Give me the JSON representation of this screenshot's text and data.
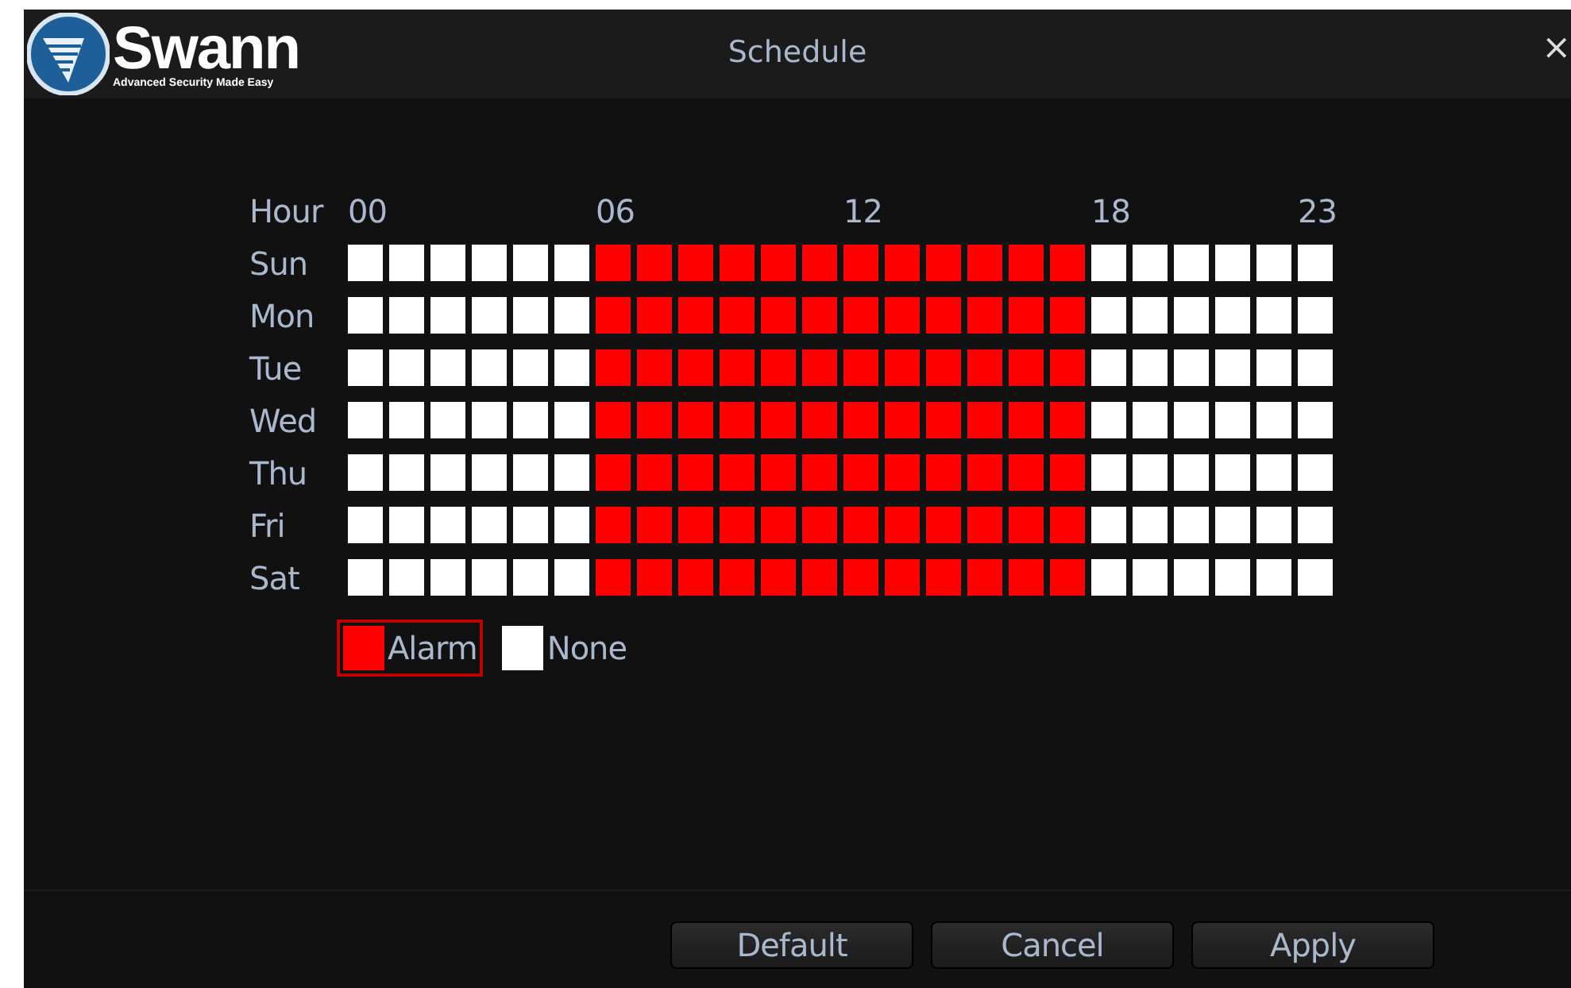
{
  "logo": {
    "name": "Swann",
    "tagline": "Advanced Security Made Easy"
  },
  "window": {
    "title": "Schedule",
    "close": "×"
  },
  "schedule": {
    "hour_label": "Hour",
    "hour_ticks": [
      "00",
      "06",
      "12",
      "18",
      "23"
    ],
    "days": [
      {
        "label": "Sun",
        "alarm_hours": [
          false,
          false,
          false,
          false,
          false,
          false,
          true,
          true,
          true,
          true,
          true,
          true,
          true,
          true,
          true,
          true,
          true,
          true,
          false,
          false,
          false,
          false,
          false,
          false
        ]
      },
      {
        "label": "Mon",
        "alarm_hours": [
          false,
          false,
          false,
          false,
          false,
          false,
          true,
          true,
          true,
          true,
          true,
          true,
          true,
          true,
          true,
          true,
          true,
          true,
          false,
          false,
          false,
          false,
          false,
          false
        ]
      },
      {
        "label": "Tue",
        "alarm_hours": [
          false,
          false,
          false,
          false,
          false,
          false,
          true,
          true,
          true,
          true,
          true,
          true,
          true,
          true,
          true,
          true,
          true,
          true,
          false,
          false,
          false,
          false,
          false,
          false
        ]
      },
      {
        "label": "Wed",
        "alarm_hours": [
          false,
          false,
          false,
          false,
          false,
          false,
          true,
          true,
          true,
          true,
          true,
          true,
          true,
          true,
          true,
          true,
          true,
          true,
          false,
          false,
          false,
          false,
          false,
          false
        ]
      },
      {
        "label": "Thu",
        "alarm_hours": [
          false,
          false,
          false,
          false,
          false,
          false,
          true,
          true,
          true,
          true,
          true,
          true,
          true,
          true,
          true,
          true,
          true,
          true,
          false,
          false,
          false,
          false,
          false,
          false
        ]
      },
      {
        "label": "Fri",
        "alarm_hours": [
          false,
          false,
          false,
          false,
          false,
          false,
          true,
          true,
          true,
          true,
          true,
          true,
          true,
          true,
          true,
          true,
          true,
          true,
          false,
          false,
          false,
          false,
          false,
          false
        ]
      },
      {
        "label": "Sat",
        "alarm_hours": [
          false,
          false,
          false,
          false,
          false,
          false,
          true,
          true,
          true,
          true,
          true,
          true,
          true,
          true,
          true,
          true,
          true,
          true,
          false,
          false,
          false,
          false,
          false,
          false
        ]
      }
    ],
    "legend": [
      {
        "kind": "alarm",
        "label": "Alarm",
        "selected": true
      },
      {
        "kind": "none",
        "label": "None",
        "selected": false
      }
    ]
  },
  "buttons": [
    "Default",
    "Cancel",
    "Apply"
  ]
}
